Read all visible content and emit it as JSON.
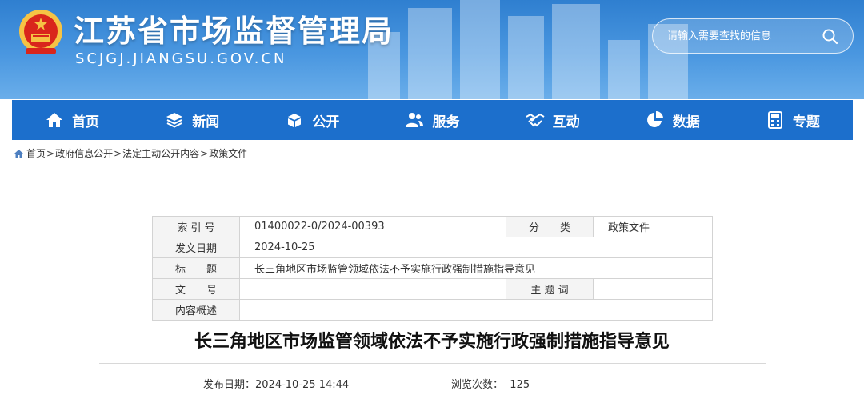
{
  "header": {
    "site_title": "江苏省市场监督管理局",
    "site_domain": "SCJGJ.JIANGSU.GOV.CN",
    "emblem_icon": "national-emblem-icon",
    "search": {
      "placeholder": "请输入需要查找的信息",
      "icon": "search-icon"
    }
  },
  "nav": {
    "items": [
      {
        "label": "首页",
        "icon": "home-icon"
      },
      {
        "label": "新闻",
        "icon": "layers-icon"
      },
      {
        "label": "公开",
        "icon": "open-box-icon"
      },
      {
        "label": "服务",
        "icon": "users-icon"
      },
      {
        "label": "互动",
        "icon": "handshake-icon"
      },
      {
        "label": "数据",
        "icon": "pie-chart-icon"
      },
      {
        "label": "专题",
        "icon": "calculator-icon"
      }
    ],
    "color": "#1c6fcc"
  },
  "breadcrumb": {
    "items": [
      "首页",
      "政府信息公开",
      "法定主动公开内容",
      "政策文件"
    ],
    "separator": ">"
  },
  "meta_table": {
    "index_label": "索 引 号",
    "index_value": "01400022-0/2024-00393",
    "category_label": "分　　类",
    "category_value": "政策文件",
    "date_label": "发文日期",
    "date_value": "2024-10-25",
    "title_label": "标　　题",
    "title_value": "长三角地区市场监管领域依法不予实施行政强制措施指导意见",
    "docno_label": "文　　号",
    "docno_value": "",
    "subject_label": "主 题 词",
    "subject_value": "",
    "summary_label": "内容概述",
    "summary_value": ""
  },
  "article": {
    "title": "长三角地区市场监管领域依法不予实施行政强制措施指导意见",
    "publish_label": "发布日期：",
    "publish_value": "2024-10-25 14:44",
    "views_label": "浏览次数：",
    "views_value": "125"
  }
}
